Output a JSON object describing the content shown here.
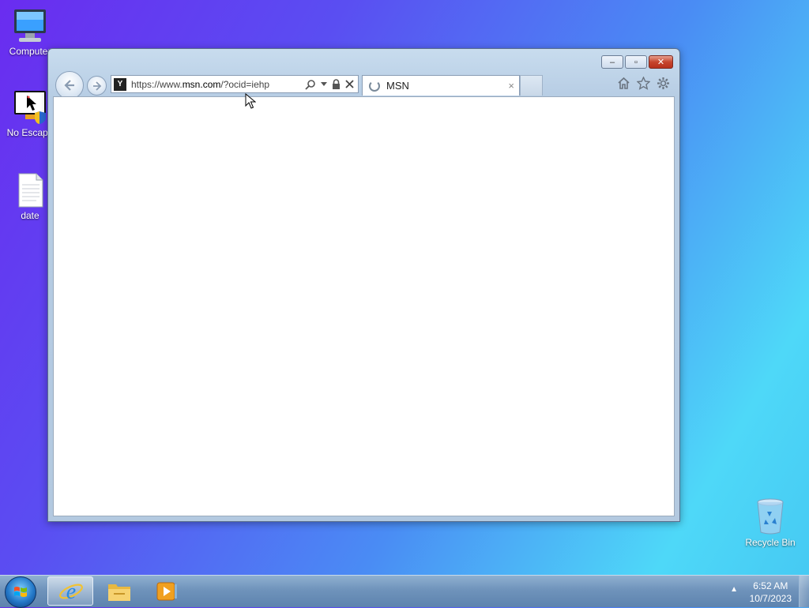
{
  "desktop": {
    "icons": [
      {
        "label": "Computer",
        "icon": "computer-icon"
      },
      {
        "label": "No Escape",
        "icon": "no-escape-icon"
      },
      {
        "label": "date",
        "icon": "text-file-icon"
      },
      {
        "label": "Recycle Bin",
        "icon": "recycle-bin-icon"
      }
    ]
  },
  "browser": {
    "app": "Internet Explorer",
    "address": {
      "url_prefix": "https://www.",
      "url_domain": "msn.com",
      "url_suffix": "/?ocid=iehp",
      "favicon_letter": "Y"
    },
    "tab": {
      "label": "MSN",
      "loading": true,
      "close": "×"
    },
    "caption_buttons": {
      "minimize": "–",
      "maximize": "▫",
      "close": "✕"
    },
    "toolbar_icons": [
      "home-icon",
      "favorites-star-icon",
      "settings-gear-icon"
    ]
  },
  "taskbar": {
    "clock_time": "6:52 AM",
    "clock_date": "10/7/2023",
    "pinned": [
      "internet-explorer-icon",
      "file-explorer-icon",
      "media-player-icon"
    ],
    "tray_arrow": "▲"
  },
  "colors": {
    "accent": "#3a6fb0",
    "close_red": "#c6452d"
  }
}
